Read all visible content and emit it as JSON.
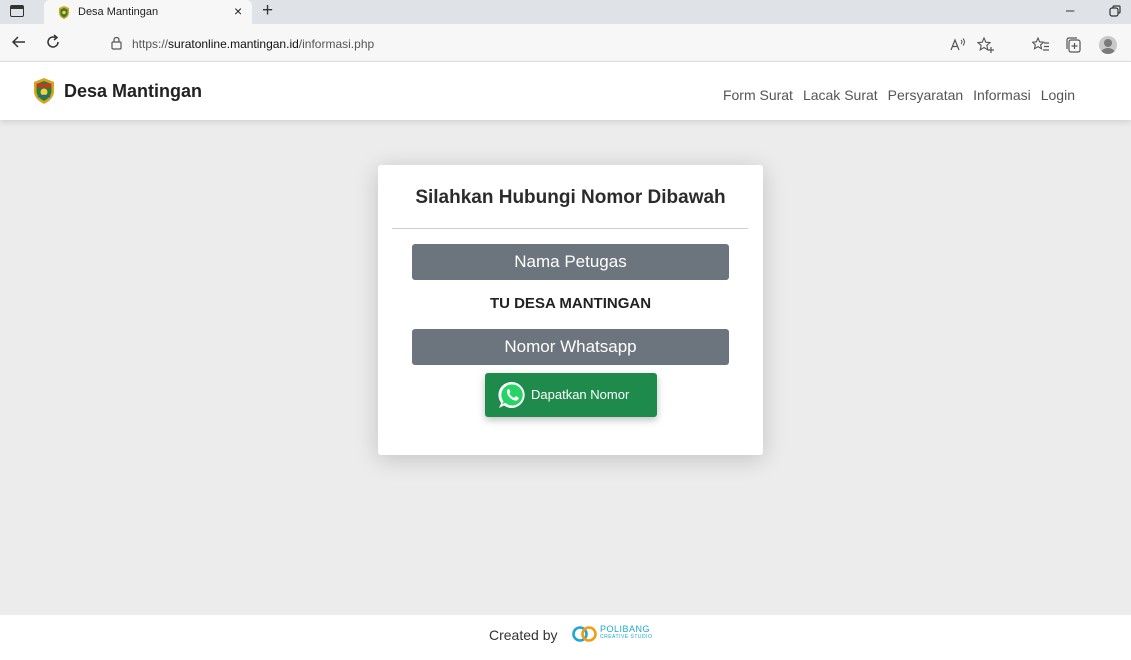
{
  "browser": {
    "tab_title": "Desa Mantingan",
    "tab_close": "×",
    "new_tab": "+",
    "minimize": "–",
    "url_prefix": "https://",
    "url_host": "suratonline.mantingan.id",
    "url_path": "/informasi.php"
  },
  "navbar": {
    "brand": "Desa Mantingan",
    "links": [
      "Form Surat",
      "Lacak Surat",
      "Persyaratan",
      "Informasi",
      "Login"
    ]
  },
  "card": {
    "title": "Silahkan Hubungi Nomor Dibawah",
    "officer_label": "Nama Petugas",
    "officer_name": "TU DESA MANTINGAN",
    "whatsapp_label": "Nomor Whatsapp",
    "whatsapp_button": "Dapatkan Nomor"
  },
  "footer": {
    "text": "Created by",
    "brand_top": "POLIBANG",
    "brand_bottom": "CREATIVE STUDIO"
  },
  "colors": {
    "bar": "#6c757d",
    "whatsapp_button": "#1e8a4b",
    "page_background": "#ececec",
    "footer_brand": "#1ea8cf"
  },
  "icons": [
    "tab-actions-icon",
    "village-emblem-icon",
    "close-icon",
    "plus-icon",
    "minimize-icon",
    "restore-icon",
    "back-arrow-icon",
    "reload-icon",
    "lock-icon",
    "read-aloud-icon",
    "favorites-add-icon",
    "favorites-icon",
    "collections-icon",
    "profile-icon",
    "whatsapp-icon",
    "polibang-logo-icon"
  ]
}
